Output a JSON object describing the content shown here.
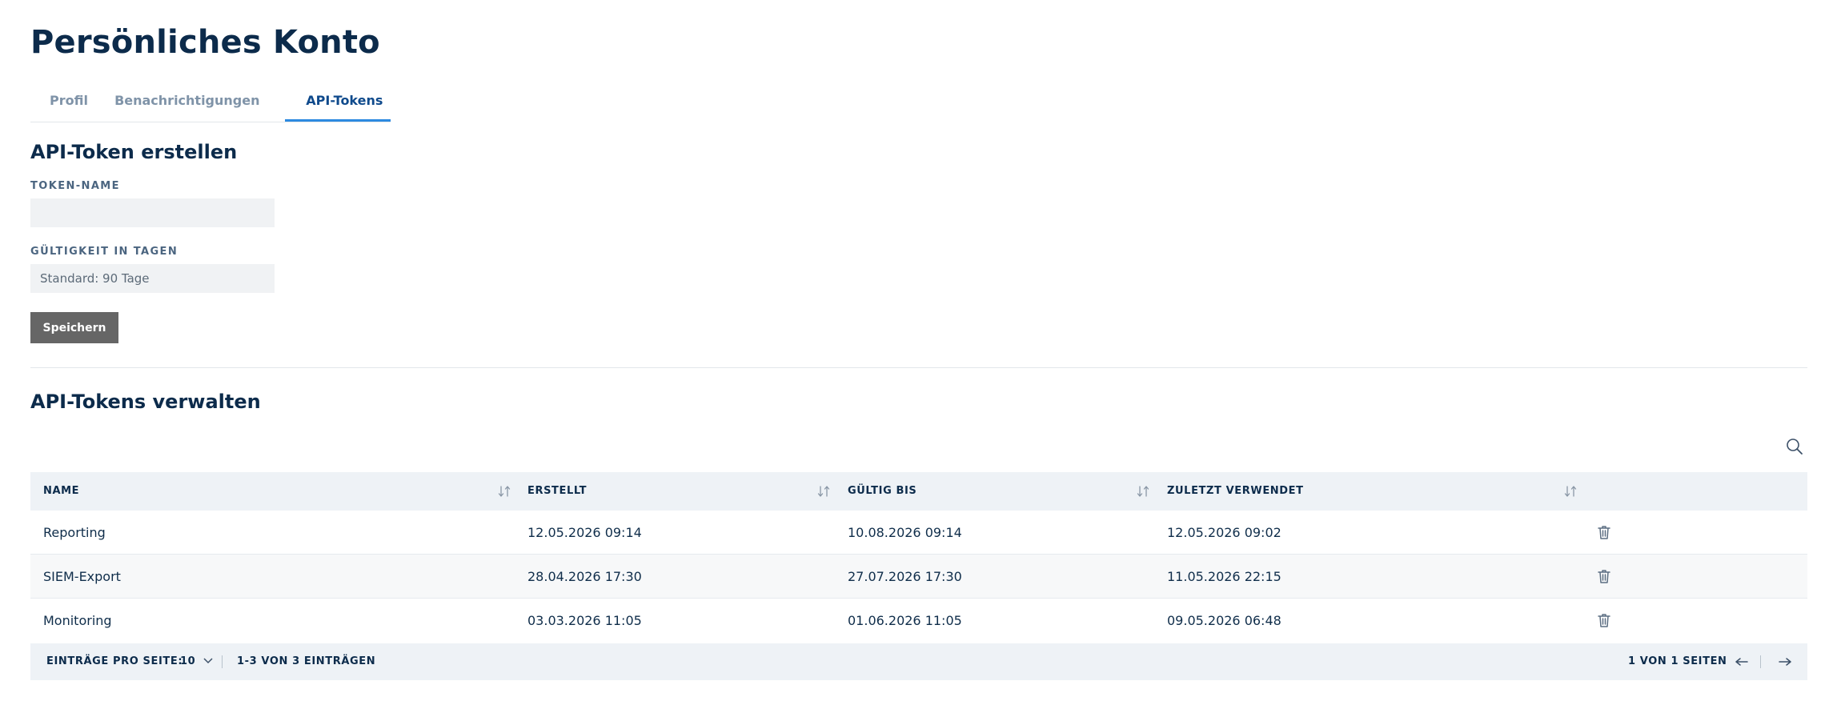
{
  "page": {
    "title": "Persönliches Konto"
  },
  "tabs": [
    {
      "label": "Profil",
      "active": false
    },
    {
      "label": "Benachrichtigungen",
      "active": false
    },
    {
      "label": "API-Tokens",
      "active": true
    }
  ],
  "create_section": {
    "title": "API-Token erstellen",
    "token_name": {
      "label": "TOKEN-NAME",
      "value": "",
      "placeholder": ""
    },
    "validity": {
      "label": "GÜLTIGKEIT IN TAGEN",
      "value": "",
      "placeholder": "Standard: 90 Tage"
    },
    "save_label": "Speichern"
  },
  "manage_section": {
    "title": "API-Tokens verwalten",
    "search_icon": "search-icon",
    "columns": [
      {
        "label": "NAME",
        "sortable": true
      },
      {
        "label": "ERSTELLT",
        "sortable": true
      },
      {
        "label": "GÜLTIG BIS",
        "sortable": true
      },
      {
        "label": "ZULETZT VERWENDET",
        "sortable": true
      }
    ],
    "rows": [
      {
        "name": "Reporting",
        "created": "12.05.2026 09:14",
        "valid_until": "10.08.2026 09:14",
        "last_used": "12.05.2026 09:02"
      },
      {
        "name": "SIEM-Export",
        "created": "28.04.2026 17:30",
        "valid_until": "27.07.2026 17:30",
        "last_used": "11.05.2026 22:15"
      },
      {
        "name": "Monitoring",
        "created": "03.03.2026 11:05",
        "valid_until": "01.06.2026 11:05",
        "last_used": "09.05.2026 06:48"
      }
    ],
    "footer": {
      "per_page_label": "EINTRÄGE PRO SEITE:",
      "per_page_value": "10",
      "range_text": "1-3 VON 3 EINTRÄGEN",
      "page_text": "1 VON 1 SEITEN"
    }
  },
  "colors": {
    "title": "#0c2b4b",
    "tab_active": "#0f4a8c",
    "tab_indicator": "#2d8ae0",
    "tab_inactive": "#7f93a8",
    "save_button": "#666666",
    "table_header_bg": "#eef2f6"
  }
}
